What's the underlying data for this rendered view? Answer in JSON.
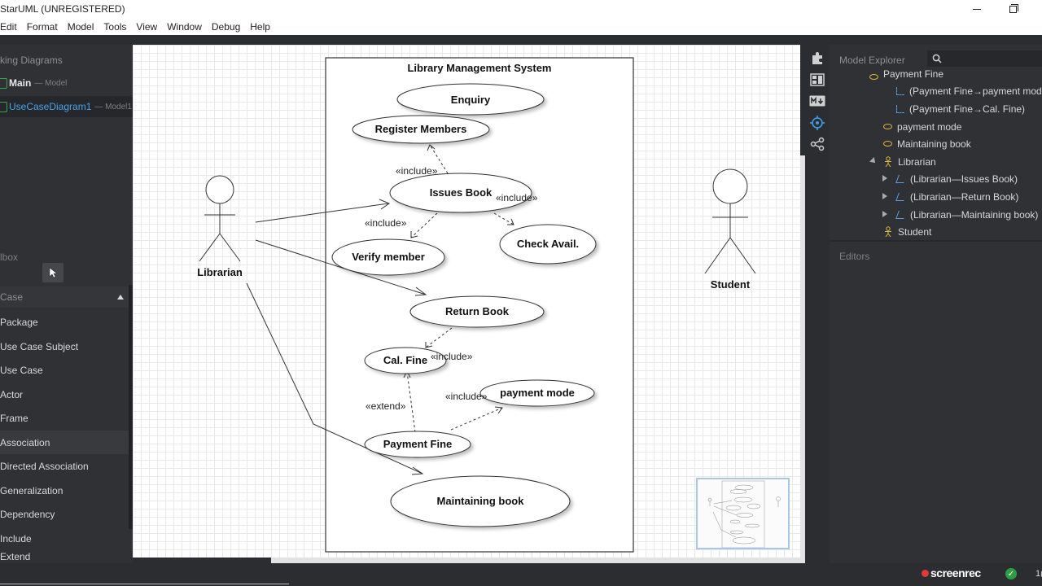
{
  "app": {
    "title": "StarUML (UNREGISTERED)",
    "menu": [
      "Edit",
      "Format",
      "Model",
      "Tools",
      "View",
      "Window",
      "Debug",
      "Help"
    ]
  },
  "working_diagrams": {
    "header": "king Diagrams",
    "items": [
      {
        "name": "Main",
        "sub": "— Model"
      },
      {
        "name": "UseCaseDiagram1",
        "sub": "— Model1"
      }
    ]
  },
  "toolbox": {
    "header": "lbox",
    "section": "Case",
    "items": [
      "Package",
      "Use Case Subject",
      "Use Case",
      "Actor",
      "Frame",
      "Association",
      "Directed Association",
      "Generalization",
      "Dependency",
      "Include",
      "Extend"
    ]
  },
  "explorer": {
    "header": "Model Explorer",
    "search_placeholder": "",
    "items": [
      {
        "label": "Payment Fine",
        "icon": "usecase-icon"
      },
      {
        "label": "(Payment Fine→payment mode)",
        "icon": "include-icon"
      },
      {
        "label": "(Payment Fine→Cal. Fine)",
        "icon": "extend-icon"
      },
      {
        "label": "payment mode",
        "icon": "usecase-icon"
      },
      {
        "label": "Maintaining book",
        "icon": "usecase-icon"
      },
      {
        "label": "Librarian",
        "icon": "actor-icon"
      },
      {
        "label": "(Librarian—Issues Book)",
        "icon": "association-icon"
      },
      {
        "label": "(Librarian—Return Book)",
        "icon": "association-icon"
      },
      {
        "label": "(Librarian—Maintaining book)",
        "icon": "association-icon"
      },
      {
        "label": "Student",
        "icon": "actor-icon"
      }
    ]
  },
  "editors": {
    "header": "Editors"
  },
  "diagram": {
    "subject": "Library Management System",
    "actors": {
      "librarian": "Librarian",
      "student": "Student"
    },
    "usecases": {
      "enquiry": "Enquiry",
      "register": "Register Members",
      "issues": "Issues Book",
      "check": "Check Avail.",
      "verify": "Verify member",
      "return": "Return Book",
      "calfine": "Cal. Fine",
      "payment_mode": "payment mode",
      "payment_fine": "Payment Fine",
      "maintaining": "Maintaining book"
    },
    "stereotypes": {
      "include": "«include»",
      "extend": "«extend»"
    }
  },
  "status": {
    "recorder": "screenrec",
    "number": "1("
  },
  "colors": {
    "panel": "#2f3135",
    "accent_blue": "#4aa3e8",
    "diagram_green": "#3fa14f",
    "usecase_yellow": "#e0b840"
  }
}
